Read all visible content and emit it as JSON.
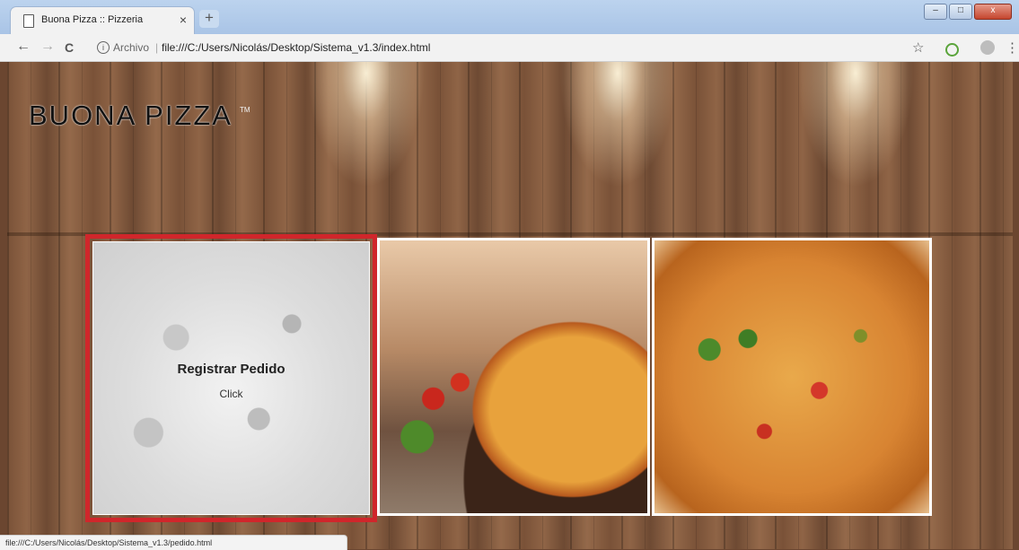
{
  "browser": {
    "tab_title": "Buona Pizza :: Pizzeria",
    "tab_close": "×",
    "new_tab": "+",
    "back": "←",
    "forward": "→",
    "reload": "C",
    "info_icon": "i",
    "security_label": "Archivo",
    "separator": "|",
    "url": "file:///C:/Users/Nicolás/Desktop/Sistema_v1.3/index.html",
    "star": "☆",
    "menu": "⋮",
    "window_controls": {
      "minimize": "–",
      "maximize": "□",
      "close": "x"
    }
  },
  "page": {
    "logo": "BUONA PIZZA",
    "logo_mark": "TM",
    "accent_color": "#d0262b",
    "cards": [
      {
        "title": "Registrar Pedido",
        "subtitle": "Click",
        "image": "pizza-grayscale"
      },
      {
        "image": "pizza-with-vegetables"
      },
      {
        "image": "pizza-top-view"
      }
    ]
  },
  "status_bar": {
    "link": "file:///C:/Users/Nicolás/Desktop/Sistema_v1.3/pedido.html"
  }
}
